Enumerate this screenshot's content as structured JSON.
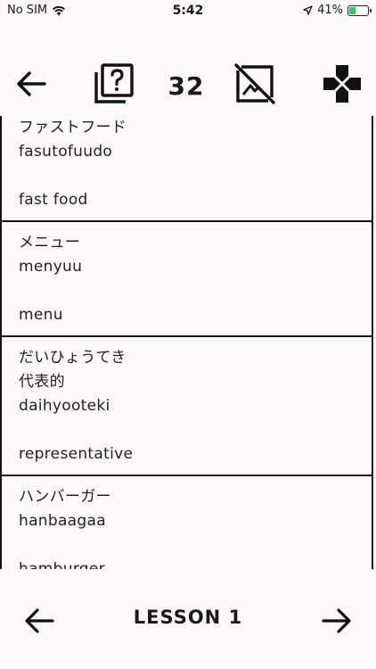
{
  "status": {
    "carrier": "No SIM",
    "time": "5:42",
    "battery": "41%",
    "battery_level": 0.41
  },
  "toolbar": {
    "count": "32",
    "icons": [
      "arrow-left-icon",
      "quiz-cards-icon",
      "image-off-icon",
      "gamepad-icon"
    ]
  },
  "cards": [
    {
      "lines": [
        "ファストフード",
        "fasutofuudo"
      ],
      "meaning": "fast food"
    },
    {
      "lines": [
        "メニュー",
        "menyuu"
      ],
      "meaning": "menu"
    },
    {
      "lines": [
        "だいひょうてき",
        "代表的",
        "daihyooteki"
      ],
      "meaning": "representative"
    },
    {
      "lines": [
        "ハンバーガー",
        "hanbaagaa"
      ],
      "meaning": "hamburger"
    }
  ],
  "footer": {
    "lesson_label": "LESSON 1"
  }
}
